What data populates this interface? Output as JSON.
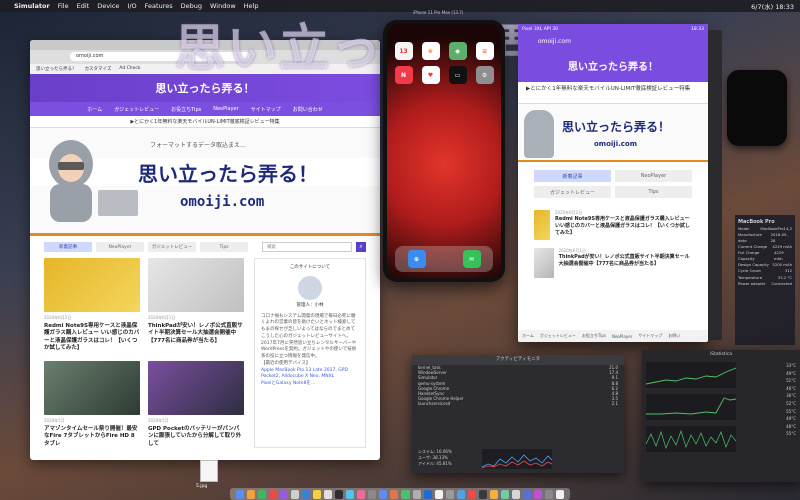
{
  "menubar": {
    "app": "Simulator",
    "items": [
      "File",
      "Edit",
      "Device",
      "I/O",
      "Features",
      "Debug",
      "Window",
      "Help"
    ],
    "clock": "6/7(水) 18:33"
  },
  "overlay_title": "思い立ったら弄る！",
  "browser": {
    "url": "omoiji.com",
    "bookmarks": [
      "思い立ったら弄る！",
      "カスタマイズ",
      "Ad Check"
    ],
    "site_title": "思い立ったら弄る！",
    "nav": [
      "ホーム",
      "ガジェットレビュー",
      "お役立ちTips",
      "NeoPlayer",
      "サイトマップ",
      "お問い合わせ"
    ],
    "promo": "▶とにかく1年無料な楽天モバイルUN-LIMIT徹底検証レビュー特集",
    "hero_tagline": "フォーマットするデータ取込まえ…",
    "hero_title": "思い立ったら弄る！",
    "hero_domain": "omoiji.com",
    "tabs": [
      "新着記事",
      "NeoPlayer",
      "ガジェットレビュー",
      "Tips"
    ],
    "search_placeholder": "検索",
    "articles": [
      {
        "date": "2020年6月2日",
        "title": "Redmi Note9S専用ケースと液晶保護ガラス購入レビュー いい感じのカバーと液晶保護ガラスはコレ！【いくつか試してみた】"
      },
      {
        "date": "2020年6月1日",
        "title": "ThinkPadが安い！レノボ公式直販サイト半期決算セール大抽選会開催中【777名に商品券が当たる】"
      },
      {
        "date": "2020年5月",
        "title": "アマゾンタイムセール祭り開催！最安なFire 7タブレットからFire HD 8タブレ"
      },
      {
        "date": "2020年5月",
        "title": "GPD Pocketのバッテリーがパンパンに膨張していたから分解して取り外して"
      }
    ],
    "sidebar_heading": "このサイトについて",
    "sidebar_name": "管理人：小林",
    "sidebar_text": "コロナ禍もシステム開発の現場で毎日必死に働くよれの営業の皆を助けたいとネット検索してもまの探せが乏しいよってはならのでまとめてこうした心のガジェットレビューサイトへ。",
    "sidebar_text2": "2017年7月に突然思い立ちレンタルサーバーやWordPressを契約。ガジェットやの使いで技術系の役に立つ情報を発信中。",
    "sidebar_links": [
      "【最近の使用デバイス】",
      "Apple MacBook Pro 13 Late 2017, GPD Pocket2, Alldocube X Neo, MNXL",
      "PixelとGalaxy Note8を..."
    ]
  },
  "iphone": {
    "label": "iPhone 11 Pro Max (13.7)",
    "apps": [
      {
        "name": "calendar-app",
        "text": "13",
        "color": "#f4f4f4",
        "fg": "#e33"
      },
      {
        "name": "photos-app",
        "text": "❀",
        "color": "#ffffff",
        "fg": "#e84"
      },
      {
        "name": "maps-app",
        "text": "◆",
        "color": "#5bb06a",
        "fg": "#fff"
      },
      {
        "name": "reminders-app",
        "text": "≡",
        "color": "#ffffff",
        "fg": "#f63"
      },
      {
        "name": "news-app",
        "text": "N",
        "color": "#f33a4a",
        "fg": "#fff"
      },
      {
        "name": "health-app",
        "text": "♥",
        "color": "#ffffff",
        "fg": "#f33"
      },
      {
        "name": "wallet-app",
        "text": "▭",
        "color": "#111111",
        "fg": "#fff"
      },
      {
        "name": "settings-app",
        "text": "⚙",
        "color": "#8e8e93",
        "fg": "#fff"
      }
    ],
    "dock": [
      {
        "name": "safari-app",
        "text": "⊕",
        "color": "#3b8cf0"
      },
      {
        "name": "messages-app",
        "text": "✉",
        "color": "#36c15a"
      }
    ]
  },
  "android": {
    "label": "Pixel 3XL API 30",
    "time": "18:33",
    "url": "omoiji.com",
    "site_title": "思い立ったら弄る！",
    "promo": "▶とにかく1年無料な楽天モバイルUN-LIMIT徹底検証レビュー特集",
    "hero_title": "思い立ったら弄る！",
    "hero_domain": "omoiji.com",
    "tabs": [
      "新着記事",
      "NeoPlayer",
      "ガジェットレビュー",
      "Tips"
    ],
    "items": [
      {
        "date": "2020年6月2日",
        "title": "Redmi Note9S専用ケースと液晶保護ガラス購入レビュー いい感じのカバーと液晶保護ガラスはコレ！【いくつか試してみた】"
      },
      {
        "date": "2020年6月1日",
        "title": "ThinkPadが安い！レノボ公式直販サイト半期決算セール大抽選会開催中【777名に商品券が当たる】"
      }
    ],
    "footer": [
      "ホーム",
      "ガジェットレビュー",
      "お役立ちTips",
      "NeoPlayer",
      "サイトマップ",
      "お問い"
    ]
  },
  "sysinfo": {
    "title": "MacBook Pro",
    "rows": [
      [
        "Model",
        "MacBookPro14,2"
      ],
      [
        "Manufacture date",
        "2018-05-28"
      ],
      [
        "Current Charge",
        "4229 mAh"
      ],
      [
        "Full Charge Capacity",
        "4229 mAh"
      ],
      [
        "Design Capacity",
        "5200 mAh"
      ],
      [
        "Cycle Count",
        "312"
      ],
      [
        "Temperature",
        "33.2 °C"
      ],
      [
        "Power adapter",
        "Connected"
      ]
    ]
  },
  "activity": {
    "title": "アクティビティモニタ",
    "processes": [
      [
        "kernel_task",
        "21.0"
      ],
      [
        "WindowServer",
        "17.4"
      ],
      [
        "Simulator",
        "9.1"
      ],
      [
        "qemu-system",
        "8.8"
      ],
      [
        "Google Chrome",
        "6.2"
      ],
      [
        "HandsetSync",
        "4.8"
      ],
      [
        "Google Chrome Helper",
        "3.5"
      ],
      [
        "launchservicesd",
        "2.1"
      ]
    ],
    "summary": [
      "システム: 16.06%",
      "ユーザ: 38.13%",
      "アイドル: 45.81%"
    ]
  },
  "stats": {
    "title": "iStatistica",
    "values": [
      "33°C",
      "49°C",
      "51°C",
      "46°C",
      "36°C",
      "52°C",
      "55°C",
      "49°C",
      "48°C",
      "55°C"
    ]
  },
  "desktop_file": "5.jpg",
  "colors": {
    "site_purple": "#7c4ce0",
    "accent_orange": "#e58a1f",
    "hero_navy": "#1d2a7a",
    "dock_colors": [
      "#5b8df2",
      "#f2a33b",
      "#3fb760",
      "#e94b4b",
      "#9a5bd8",
      "#cfcfcf",
      "#3c7fd6",
      "#f5d142",
      "#e0e0e0",
      "#2e2e2e",
      "#55c1f0",
      "#f06a9a",
      "#8a8a8a",
      "#5b8df2",
      "#e0754a",
      "#4cc06a",
      "#b0b0b0",
      "#1d6cd6",
      "#f2f2f2",
      "#9a9a9a",
      "#4fa3e0",
      "#e94b4b",
      "#3a3a3a",
      "#f3b13b",
      "#6fcfa0",
      "#d6d6d6",
      "#5a6fd8",
      "#c04fd8",
      "#888888",
      "#f0f0f0"
    ]
  }
}
